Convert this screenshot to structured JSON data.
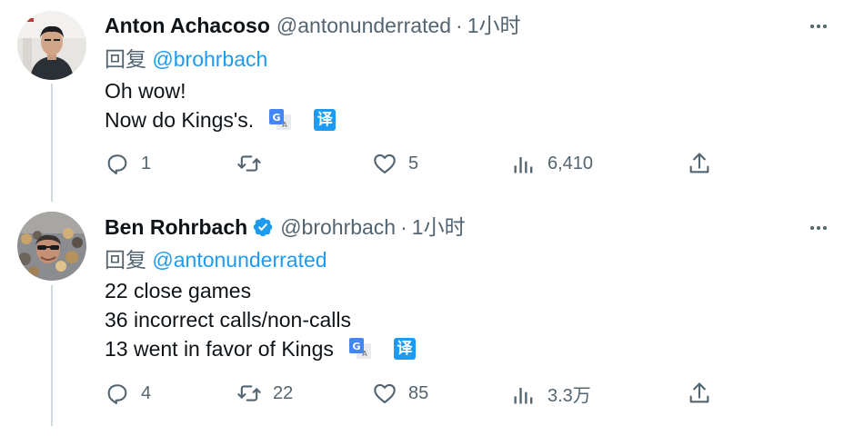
{
  "tweets": [
    {
      "display_name": "Anton Achacoso",
      "handle": "@antonunderrated",
      "dot": "·",
      "time": "1小时",
      "verified": false,
      "reply_prefix": "回复",
      "reply_to": "@brohrbach",
      "lines": [
        "Oh wow!",
        "Now do Kings's."
      ],
      "translate_badge": "译",
      "counts": {
        "replies": "1",
        "retweets": "",
        "likes": "5",
        "views": "6,410"
      }
    },
    {
      "display_name": "Ben Rohrbach",
      "handle": "@brohrbach",
      "dot": "·",
      "time": "1小时",
      "verified": true,
      "reply_prefix": "回复",
      "reply_to": "@antonunderrated",
      "lines": [
        "22 close games",
        "36 incorrect calls/non-calls",
        "13 went in favor of Kings"
      ],
      "translate_badge": "译",
      "counts": {
        "replies": "4",
        "retweets": "22",
        "likes": "85",
        "views": "3.3万"
      }
    }
  ],
  "icons": {
    "more": "more-horizontal-icon",
    "reply": "reply-icon",
    "retweet": "retweet-icon",
    "like": "heart-icon",
    "views": "views-chart-icon",
    "share": "share-icon",
    "verified": "verified-badge-icon",
    "google_translate": "google-translate-icon"
  },
  "colors": {
    "text": "#0f1419",
    "muted": "#536471",
    "accent": "#1d9bf0",
    "thread": "#cfd9de"
  }
}
